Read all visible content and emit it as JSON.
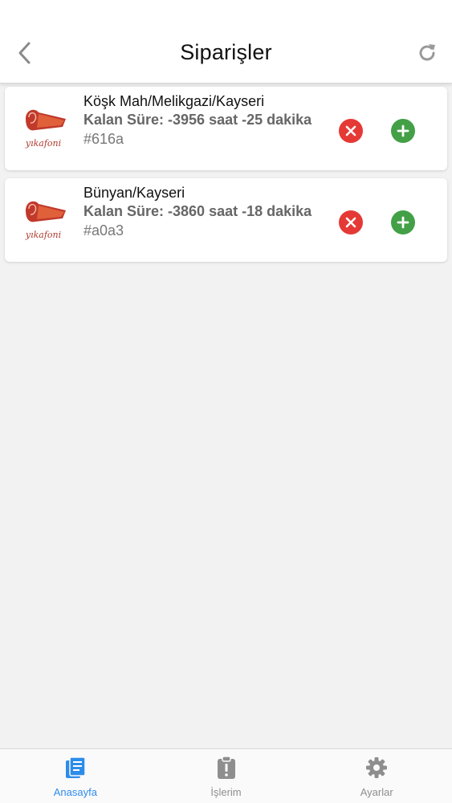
{
  "header": {
    "title": "Siparişler",
    "back_icon": "chevron-left-icon",
    "refresh_icon": "refresh-icon"
  },
  "orders": [
    {
      "logo_text": "yıkafoni",
      "address": "Köşk Mah/Melikgazi/Kayseri",
      "remaining": "Kalan Süre: -3956 saat -25 dakika",
      "code": "#616a"
    },
    {
      "logo_text": "yıkafoni",
      "address": "Bünyan/Kayseri",
      "remaining": "Kalan Süre: -3860 saat -18 dakika",
      "code": "#a0a3"
    }
  ],
  "tabs": [
    {
      "label": "Anasayfa",
      "icon": "list-document-icon",
      "active": true
    },
    {
      "label": "İşlerim",
      "icon": "clipboard-alert-icon",
      "active": false
    },
    {
      "label": "Ayarlar",
      "icon": "gear-icon",
      "active": false
    }
  ],
  "colors": {
    "accent": "#2d8ceb",
    "cancel": "#e53935",
    "accept": "#43a047",
    "inactive": "#8e8e8e"
  }
}
